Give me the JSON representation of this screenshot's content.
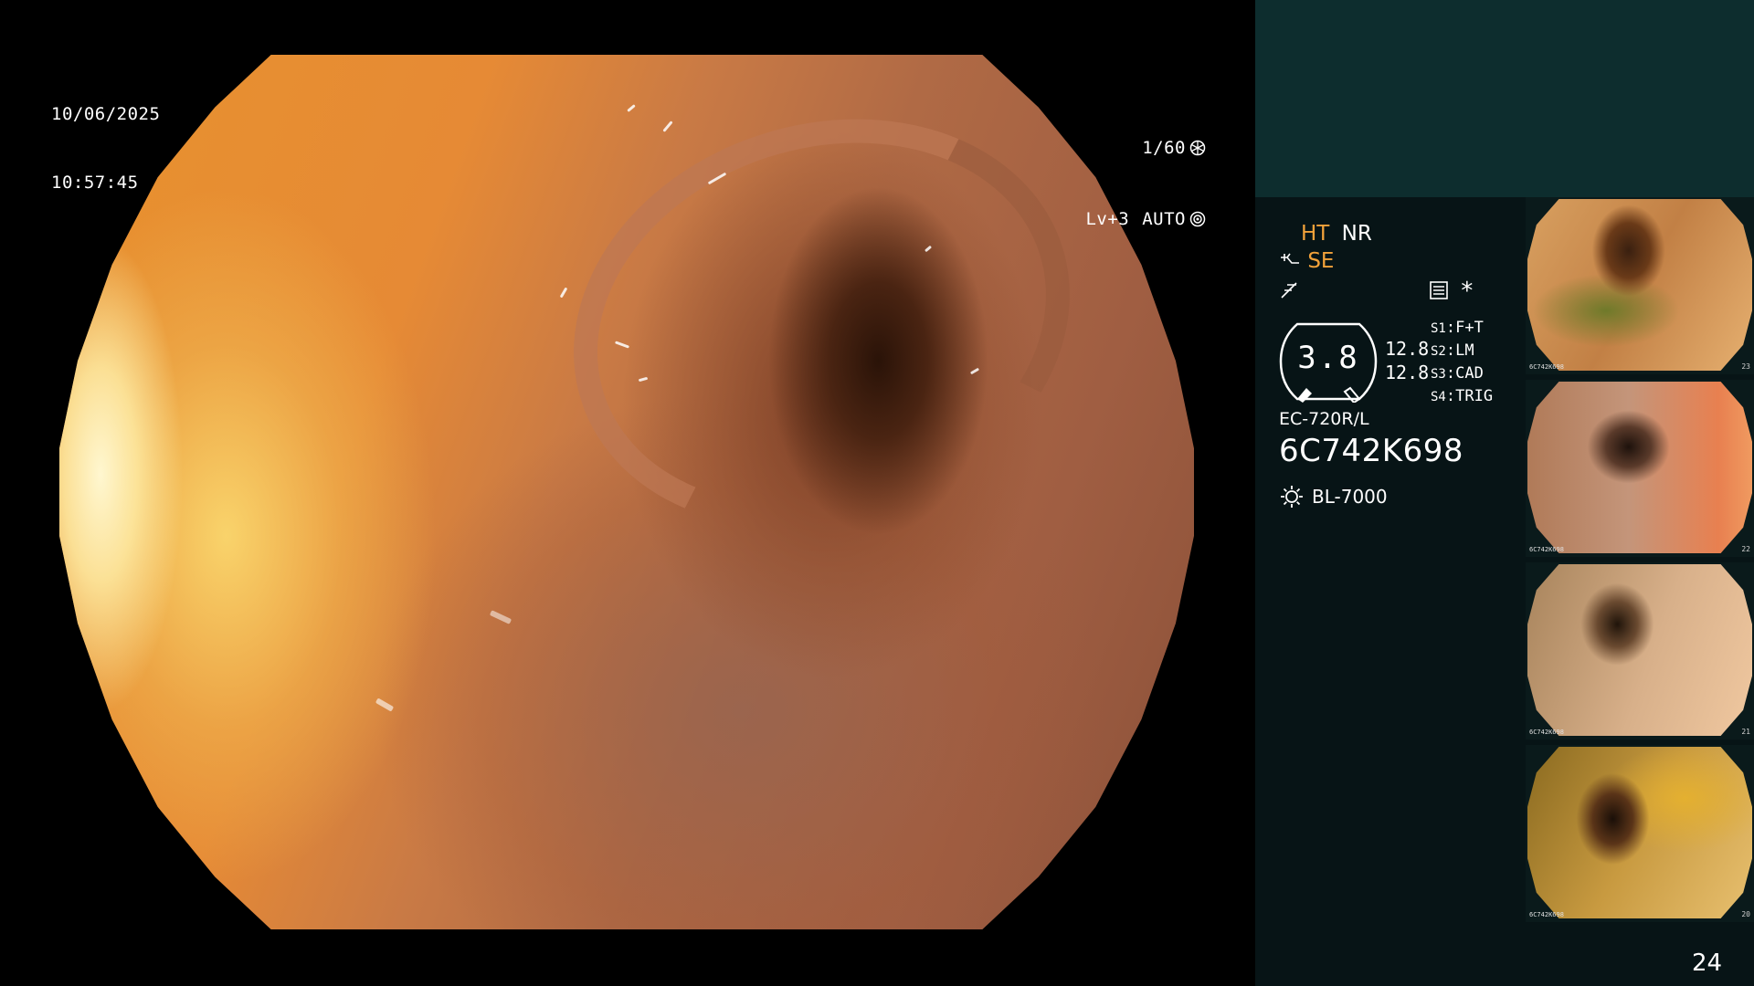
{
  "overlay": {
    "date": "10/06/2025",
    "time": "10:57:45",
    "shutter": "1/60",
    "level": "Lv+3",
    "iris_mode": "AUTO"
  },
  "panel": {
    "mode_ht": "HT",
    "mode_nr": "NR",
    "mode_se": "SE",
    "gauge_value": "3.8",
    "ratio_top": "12.8",
    "ratio_bottom": "12.8",
    "star": "*",
    "slots": [
      {
        "key": "S1",
        "value": "F+T"
      },
      {
        "key": "S2",
        "value": "LM"
      },
      {
        "key": "S3",
        "value": "CAD"
      },
      {
        "key": "S4",
        "value": "TRIG"
      }
    ],
    "scope_model": "EC-720R/L",
    "serial": "6C742K698",
    "light_source": "BL-7000"
  },
  "thumbnails": [
    {
      "id_text": "6C742K698",
      "number": "23"
    },
    {
      "id_text": "6C742K698",
      "number": "22"
    },
    {
      "id_text": "6C742K698",
      "number": "21"
    },
    {
      "id_text": "6C742K698",
      "number": "20"
    }
  ],
  "page_number": "24",
  "colors": {
    "accent_orange": "#f2a23a",
    "panel_top": "#0d2d2e",
    "panel_bottom": "#071416"
  }
}
